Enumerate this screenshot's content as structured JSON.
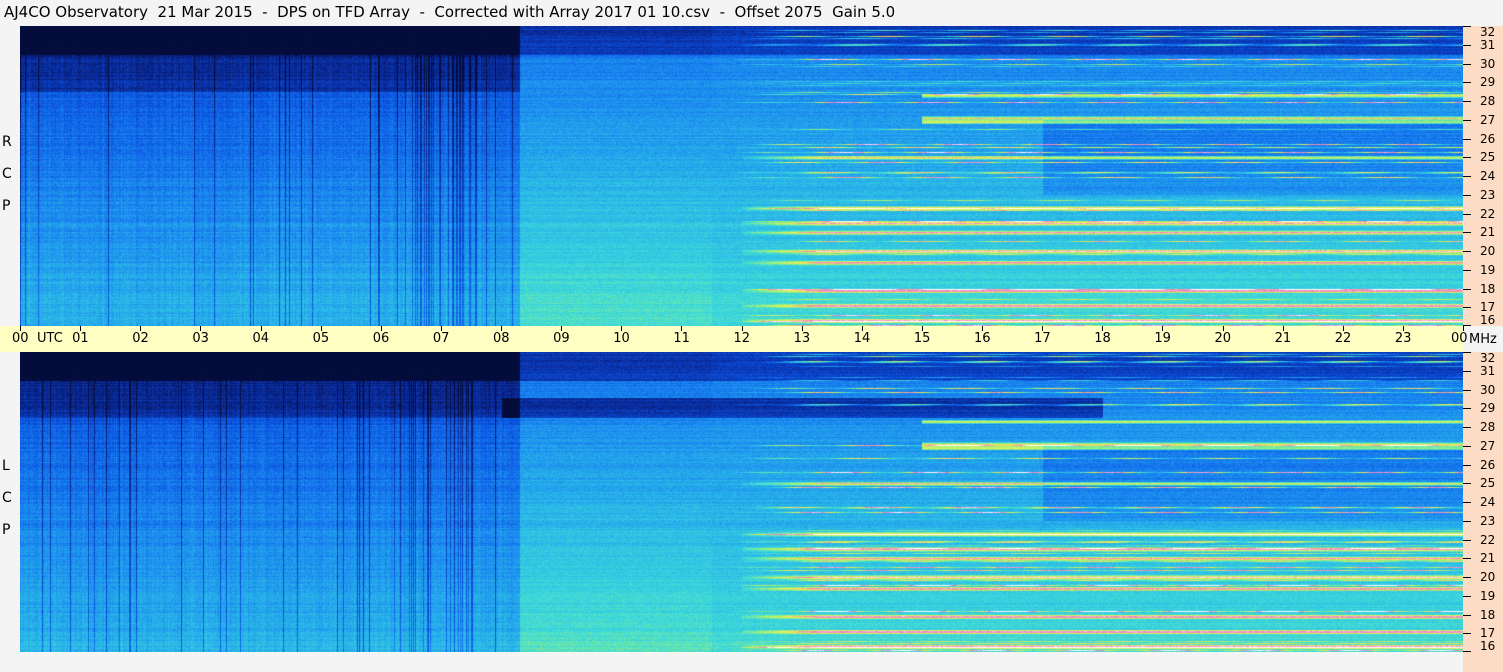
{
  "header": {
    "title": "AJ4CO Observatory  21 Mar 2015  -  DPS on TFD Array  -  Corrected with Array 2017 01 10.csv  -  Offset 2075  Gain 5.0"
  },
  "panels": [
    {
      "polarization_label": [
        "R",
        "C",
        "P"
      ]
    },
    {
      "polarization_label": [
        "L",
        "C",
        "P"
      ]
    }
  ],
  "chart_data": {
    "type": "heatmap",
    "title": "AJ4CO Observatory  21 Mar 2015  -  DPS on TFD Array  -  Corrected with Array 2017 01 10.csv  -  Offset 2075  Gain 5.0",
    "x_axis": {
      "unit_label": "UTC",
      "ticks": [
        "00",
        "01",
        "02",
        "03",
        "04",
        "05",
        "06",
        "07",
        "08",
        "09",
        "10",
        "11",
        "12",
        "13",
        "14",
        "15",
        "16",
        "17",
        "18",
        "19",
        "20",
        "21",
        "22",
        "23",
        "00"
      ],
      "range_hours": [
        0,
        24
      ]
    },
    "y_axis": {
      "unit_label": "MHz",
      "ticks": [
        "16",
        "17",
        "18",
        "19",
        "20",
        "21",
        "22",
        "23",
        "24",
        "25",
        "26",
        "27",
        "28",
        "29",
        "30",
        "31",
        "32"
      ],
      "range_mhz": [
        16,
        32
      ]
    },
    "series": [
      {
        "name": "RCP"
      },
      {
        "name": "LCP"
      }
    ],
    "colormap": [
      "#040c3c",
      "#0a2a9a",
      "#0a52e0",
      "#1a86f0",
      "#2ab8e8",
      "#40dcd8",
      "#9af07a",
      "#f0f050",
      "#f07ac8",
      "#ffffff"
    ],
    "colors": {
      "axis_band": "#ffffc4",
      "freq_scale_bg": "#fcdcc4",
      "page_bg": "#f4f4f4"
    }
  }
}
